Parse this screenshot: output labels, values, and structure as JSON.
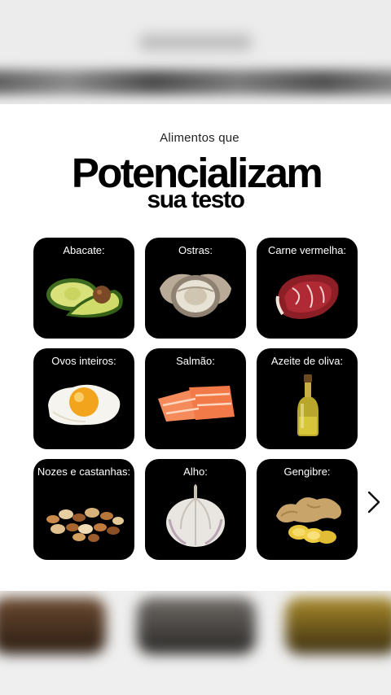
{
  "post": {
    "kicker": "Alimentos que",
    "headline": "Potencializam",
    "subhead": "sua testo"
  },
  "foods": [
    {
      "label": "Abacate:",
      "icon": "avocado-icon"
    },
    {
      "label": "Ostras:",
      "icon": "oyster-icon"
    },
    {
      "label": "Carne vermelha:",
      "icon": "red-meat-icon"
    },
    {
      "label": "Ovos inteiros:",
      "icon": "fried-egg-icon"
    },
    {
      "label": "Salmão:",
      "icon": "salmon-icon"
    },
    {
      "label": "Azeite de oliva:",
      "icon": "olive-oil-bottle-icon"
    },
    {
      "label": "Nozes e castanhas:",
      "icon": "mixed-nuts-icon"
    },
    {
      "label": "Alho:",
      "icon": "garlic-icon"
    },
    {
      "label": "Gengibre:",
      "icon": "ginger-icon"
    }
  ],
  "navigation": {
    "next_icon": "chevron-right-icon"
  }
}
